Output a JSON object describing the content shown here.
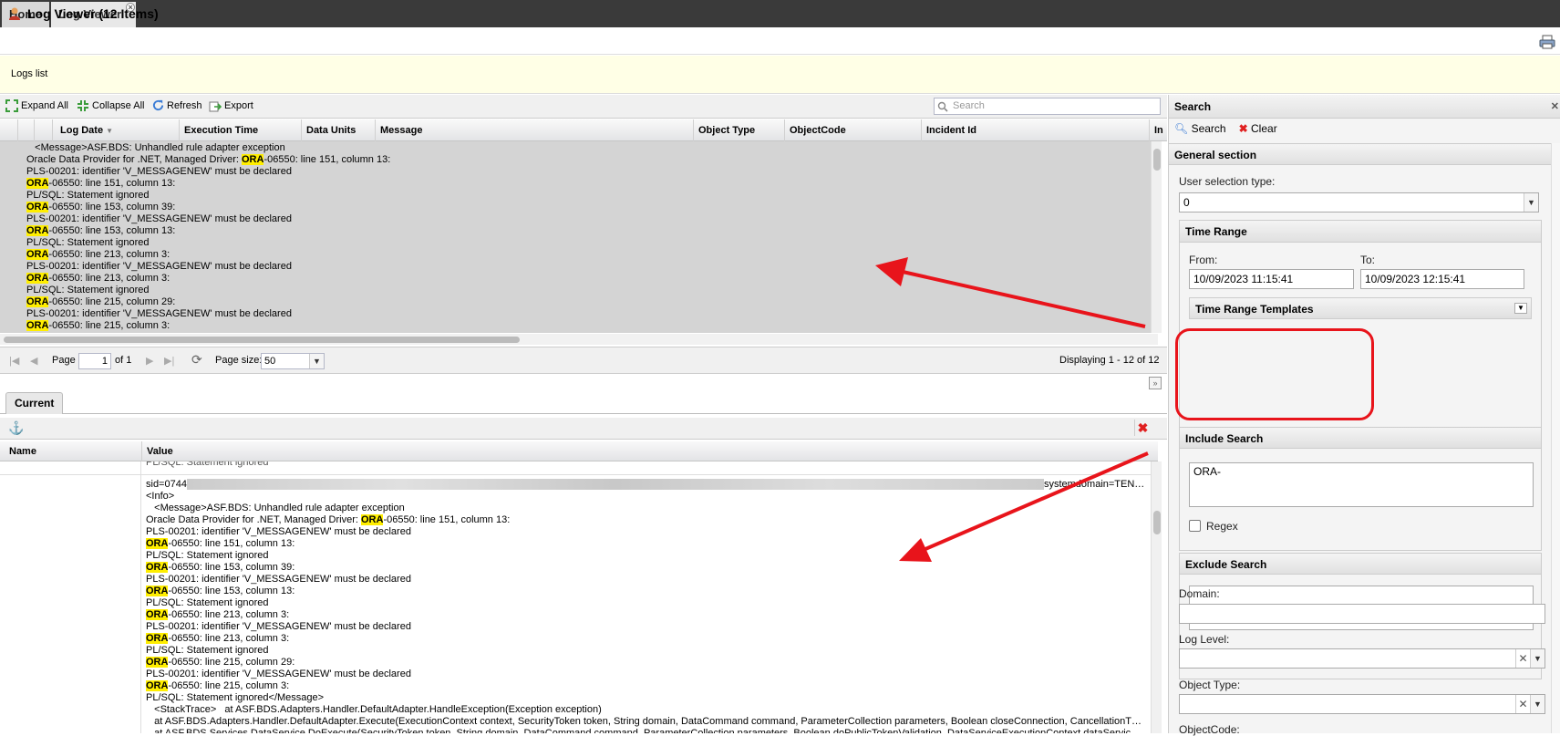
{
  "tabs": [
    {
      "label": "Home"
    },
    {
      "label": "Log Viewer"
    }
  ],
  "page": {
    "title": "Log Viewer (12 Items)",
    "subtitle": "Logs list"
  },
  "toolbar": {
    "expand_all": "Expand All",
    "collapse_all": "Collapse All",
    "refresh": "Refresh",
    "export": "Export",
    "search_placeholder": "Search"
  },
  "grid": {
    "columns": [
      "Log Date",
      "Execution Time",
      "Data Units",
      "Message",
      "Object Type",
      "ObjectCode",
      "Incident Id",
      "In"
    ],
    "row_lines": [
      [
        "   <Message>ASF.BDS: Unhandled rule adapter exception",
        "",
        ""
      ],
      [
        "Oracle Data Provider for .NET, Managed Driver: ",
        "ORA",
        "-06550: line 151, column 13:"
      ],
      [
        "PLS-00201: identifier 'V_MESSAGENEW' must be declared",
        "",
        ""
      ],
      [
        "",
        "ORA",
        "-06550: line 151, column 13:"
      ],
      [
        "PL/SQL: Statement ignored",
        "",
        ""
      ],
      [
        "",
        "ORA",
        "-06550: line 153, column 39:"
      ],
      [
        "PLS-00201: identifier 'V_MESSAGENEW' must be declared",
        "",
        ""
      ],
      [
        "",
        "ORA",
        "-06550: line 153, column 13:"
      ],
      [
        "PL/SQL: Statement ignored",
        "",
        ""
      ],
      [
        "",
        "ORA",
        "-06550: line 213, column 3:"
      ],
      [
        "PLS-00201: identifier 'V_MESSAGENEW' must be declared",
        "",
        ""
      ],
      [
        "",
        "ORA",
        "-06550: line 213, column 3:"
      ],
      [
        "PL/SQL: Statement ignored",
        "",
        ""
      ],
      [
        "",
        "ORA",
        "-06550: line 215, column 29:"
      ],
      [
        "PLS-00201: identifier 'V_MESSAGENEW' must be declared",
        "",
        ""
      ],
      [
        "",
        "ORA",
        "-06550: line 215, column 3:"
      ]
    ]
  },
  "pager": {
    "page_label": "Page",
    "page_value": "1",
    "of_label": "of 1",
    "size_label": "Page size:",
    "size_value": "50",
    "display": "Displaying 1 - 12 of 12"
  },
  "detail": {
    "tab": "Current",
    "name_header": "Name",
    "value_header": "Value",
    "cut_line": "PL/SQL: Statement ignored",
    "sid_prefix": "sid=0744",
    "sid_suffix": "systemdomain=TEN…",
    "lines": [
      [
        "<Info>",
        "",
        ""
      ],
      [
        "   <Message>ASF.BDS: Unhandled rule adapter exception",
        "",
        ""
      ],
      [
        "Oracle Data Provider for .NET, Managed Driver: ",
        "ORA",
        "-06550: line 151, column 13:"
      ],
      [
        "PLS-00201: identifier 'V_MESSAGENEW' must be declared",
        "",
        ""
      ],
      [
        "",
        "ORA",
        "-06550: line 151, column 13:"
      ],
      [
        "PL/SQL: Statement ignored",
        "",
        ""
      ],
      [
        "",
        "ORA",
        "-06550: line 153, column 39:"
      ],
      [
        "PLS-00201: identifier 'V_MESSAGENEW' must be declared",
        "",
        ""
      ],
      [
        "",
        "ORA",
        "-06550: line 153, column 13:"
      ],
      [
        "PL/SQL: Statement ignored",
        "",
        ""
      ],
      [
        "",
        "ORA",
        "-06550: line 213, column 3:"
      ],
      [
        "PLS-00201: identifier 'V_MESSAGENEW' must be declared",
        "",
        ""
      ],
      [
        "",
        "ORA",
        "-06550: line 213, column 3:"
      ],
      [
        "PL/SQL: Statement ignored",
        "",
        ""
      ],
      [
        "",
        "ORA",
        "-06550: line 215, column 29:"
      ],
      [
        "PLS-00201: identifier 'V_MESSAGENEW' must be declared",
        "",
        ""
      ],
      [
        "",
        "ORA",
        "-06550: line 215, column 3:"
      ],
      [
        "PL/SQL: Statement ignored</Message>",
        "",
        ""
      ],
      [
        "   <StackTrace>   at ASF.BDS.Adapters.Handler.DefaultAdapter.HandleException(Exception exception)",
        "",
        ""
      ],
      [
        "   at ASF.BDS.Adapters.Handler.DefaultAdapter.Execute(ExecutionContext context, SecurityToken token, String domain, DataCommand command, ParameterCollection parameters, Boolean closeConnection, CancellationT…",
        "",
        ""
      ],
      [
        "   at ASF.BDS.Services.DataService.DoExecute(SecurityToken token, String domain, DataCommand command, ParameterCollection parameters, Boolean doPublicTokenValidation, DataServiceExecutionContext dataServic…",
        "",
        ""
      ]
    ]
  },
  "search": {
    "title": "Search",
    "search_btn": "Search",
    "clear_btn": "Clear",
    "general_section": "General section",
    "user_selection_label": "User selection type:",
    "user_selection_value": "0",
    "time_range": "Time Range",
    "from_label": "From:",
    "from_value": "10/09/2023 11:15:41",
    "to_label": "To:",
    "to_value": "10/09/2023 12:15:41",
    "templates": "Time Range Templates",
    "include_search": "Include Search",
    "include_value": "ORA-",
    "regex": "Regex",
    "exclude_search": "Exclude Search",
    "domain_label": "Domain:",
    "log_level_label": "Log Level:",
    "object_type_label": "Object Type:",
    "object_code_label": "ObjectCode:"
  },
  "colors": {
    "highlight": "#ffee00",
    "annotation": "#e8141b",
    "log_background": "#d4d4d4",
    "notice_bar": "#ffffe6"
  }
}
